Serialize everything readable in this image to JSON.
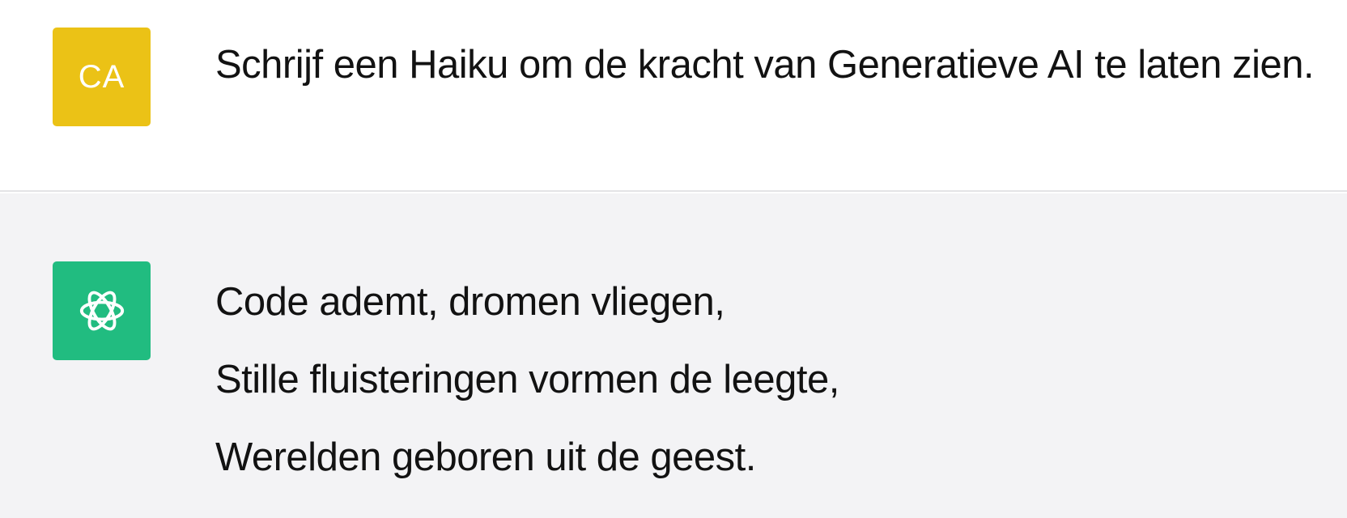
{
  "messages": {
    "user": {
      "avatar_initials": "CA",
      "avatar_color": "#ebc216",
      "text": "Schrijf een Haiku om de kracht van Generatieve AI te laten zien."
    },
    "assistant": {
      "avatar_icon": "openai-logo-icon",
      "avatar_color": "#21bc80",
      "lines": [
        "Code ademt, dromen vliegen,",
        "Stille fluisteringen vormen de leegte,",
        "Werelden geboren uit de geest."
      ]
    }
  }
}
